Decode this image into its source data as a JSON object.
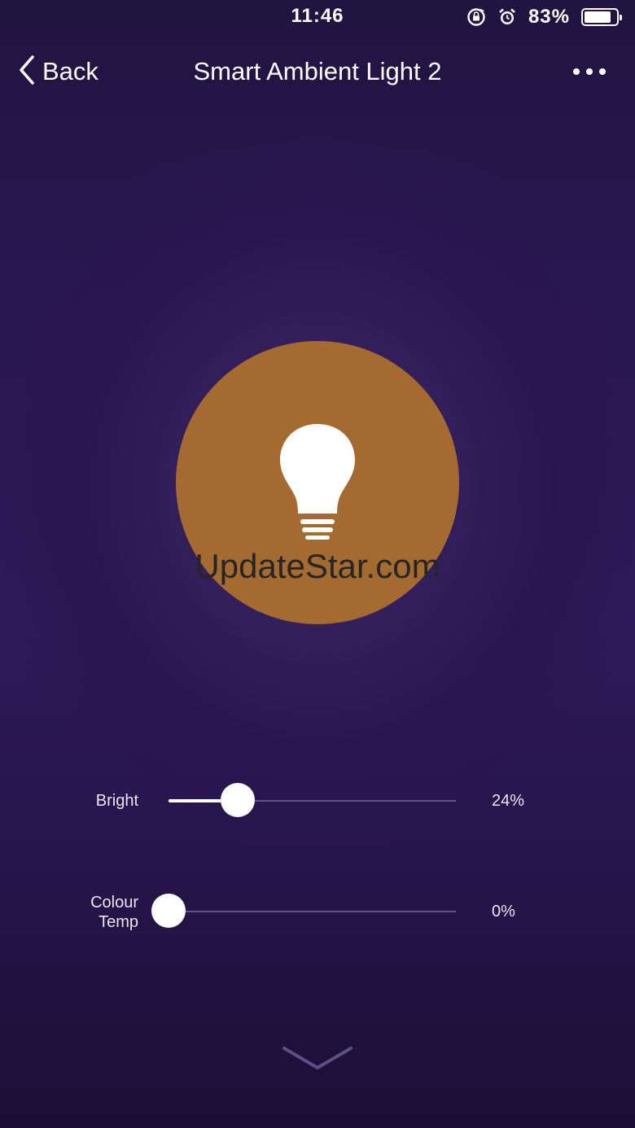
{
  "status_bar": {
    "time": "11:46",
    "battery_percent": "83%",
    "battery_level": 0.83,
    "icons": [
      "rotation-lock-icon",
      "alarm-icon",
      "battery-icon"
    ]
  },
  "nav": {
    "back_label": "Back",
    "title": "Smart Ambient Light 2",
    "more_icon": "more-dots-icon"
  },
  "bulb": {
    "color": "#a56a30",
    "icon": "lightbulb-icon"
  },
  "watermark": "UpdateStar.com",
  "sliders": {
    "brightness": {
      "label": "Bright",
      "value_text": "24%",
      "value": 0.24
    },
    "colour_temp": {
      "label_line1": "Colour",
      "label_line2": "Temp",
      "value_text": "0%",
      "value": 0
    }
  },
  "footer": {
    "expand_icon": "chevron-down-icon"
  }
}
